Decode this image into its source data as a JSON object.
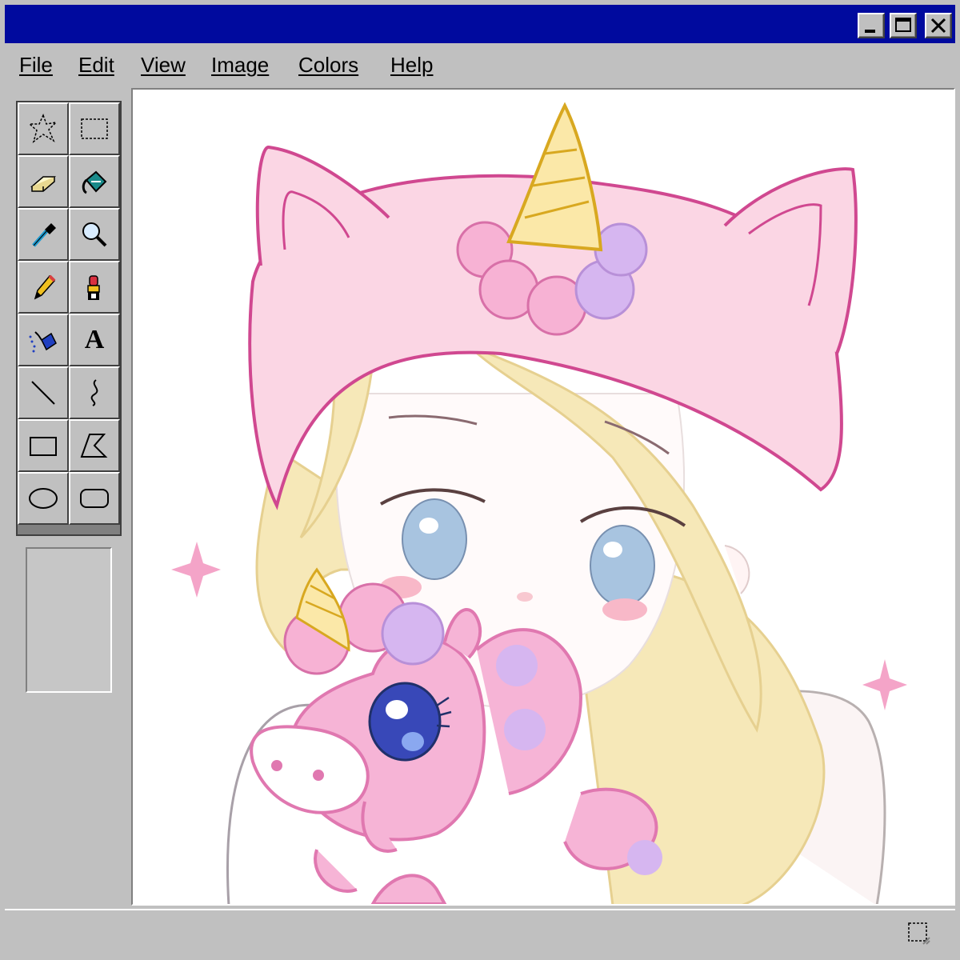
{
  "window": {
    "minimize_icon": "minimize-icon",
    "maximize_icon": "maximize-icon",
    "close_icon": "close-icon",
    "titlebar_color": "#000a9e"
  },
  "menu": {
    "items": [
      {
        "label": "File"
      },
      {
        "label": "Edit"
      },
      {
        "label": "View"
      },
      {
        "label": "Image"
      },
      {
        "label": "Colors"
      },
      {
        "label": "Help"
      }
    ]
  },
  "toolbox": {
    "tools": [
      {
        "icon": "free-form-select-icon"
      },
      {
        "icon": "rect-select-icon"
      },
      {
        "icon": "eraser-icon"
      },
      {
        "icon": "fill-bucket-icon"
      },
      {
        "icon": "color-picker-icon"
      },
      {
        "icon": "magnifier-icon"
      },
      {
        "icon": "pencil-icon"
      },
      {
        "icon": "brush-icon"
      },
      {
        "icon": "airbrush-icon"
      },
      {
        "icon": "text-icon",
        "glyph": "A"
      },
      {
        "icon": "line-icon"
      },
      {
        "icon": "curve-icon"
      },
      {
        "icon": "rectangle-icon"
      },
      {
        "icon": "polygon-icon"
      },
      {
        "icon": "ellipse-icon"
      },
      {
        "icon": "rounded-rect-icon"
      }
    ]
  },
  "status": {
    "resize_icon": "resize-grip-icon"
  }
}
